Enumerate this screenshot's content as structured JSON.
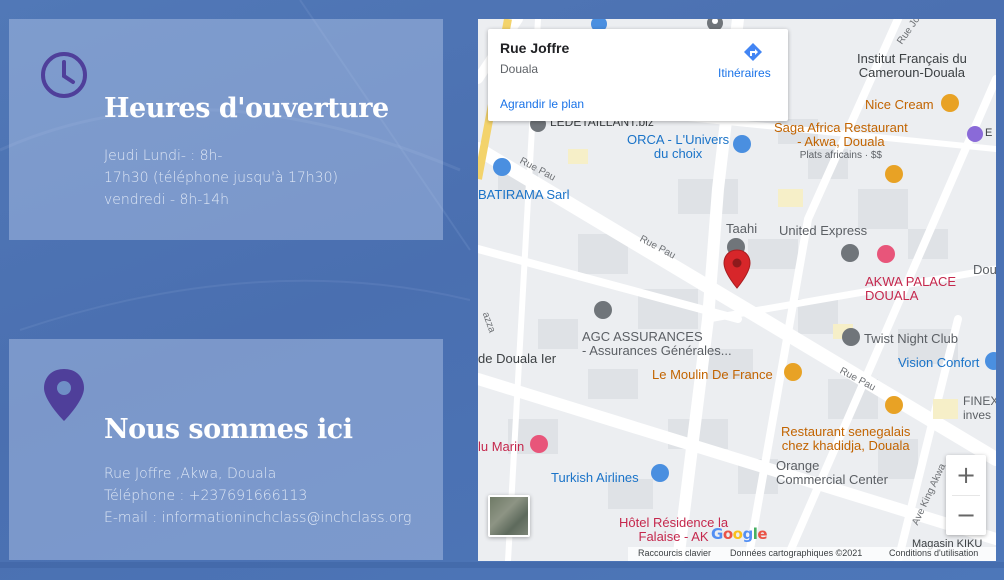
{
  "hours_card": {
    "title": "Heures d'ouverture",
    "lines": [
      "Jeudi Lundi- : 8h-",
      "17h30 (téléphone jusqu'à 17h30)",
      "vendredi - 8h-14h"
    ],
    "icon": "clock-icon"
  },
  "location_card": {
    "title": "Nous sommes ici",
    "lines": [
      "Rue Joffre ,Akwa, Douala",
      "Téléphone : +237691666113",
      "E-mail : informationinchclass@inchclass.org"
    ],
    "icon": "location-pin-icon"
  },
  "map": {
    "infobox": {
      "place": "Rue Joffre",
      "city": "Douala",
      "enlarge_link": "Agrandir le plan",
      "directions_label": "Itinéraires"
    },
    "pois": {
      "institut": [
        "Institut Français du",
        "Cameroun-Douala"
      ],
      "nice_cream": "Nice Cream",
      "saga": [
        "Saga Africa Restaurant",
        "- Akwa, Douala"
      ],
      "saga_sub": "Plats africains · $$",
      "orca": [
        "ORCA - L'Univers",
        "du choix"
      ],
      "batirama": "BATIRAMA Sarl",
      "taahi": "Taahi",
      "united": "United Express",
      "akwa_palace": [
        "AKWA PALACE",
        "DOUALA"
      ],
      "dou": "Dou",
      "agc": [
        "AGC ASSURANCES",
        "- Assurances Générales..."
      ],
      "de_douala": "de Douala Ier",
      "twist": "Twist Night Club",
      "vision": "Vision Confort",
      "moulin": "Le Moulin De France",
      "finex": [
        "FINEX",
        "inves"
      ],
      "senegalais": [
        "Restaurant senegalais",
        "chez khadidja, Douala"
      ],
      "orange": [
        "Orange",
        "Commercial Center"
      ],
      "marin": "lu Marin",
      "turkish": "Turkish Airlines",
      "hotel": [
        "Hôtel Résidence la",
        "Falaise - AK"
      ],
      "magasin": "Magasin KIKU",
      "debtaillant": "LEDETAILLANT.biz",
      "e_label": "E"
    },
    "streets": {
      "rue_pau_1": "Rue Pau",
      "rue_pau_2": "Rue Pau",
      "rue_pau_3": "Rue Pau",
      "rue_joffre_top": "Rue Jo",
      "ave_king": "Ave King Akwa",
      "azza": "azza"
    },
    "attribution": {
      "shortcuts": "Raccourcis clavier",
      "data": "Données cartographiques ©2021",
      "terms": "Conditions d'utilisation"
    },
    "zoom_in": "+",
    "zoom_out": "−",
    "logo": "Google",
    "colors": {
      "marker": "#d7262a",
      "poi_blue": "#1a73c8",
      "poi_orange": "#e8a225",
      "poi_pink": "#e8557a",
      "poi_gray": "#70757a"
    }
  }
}
